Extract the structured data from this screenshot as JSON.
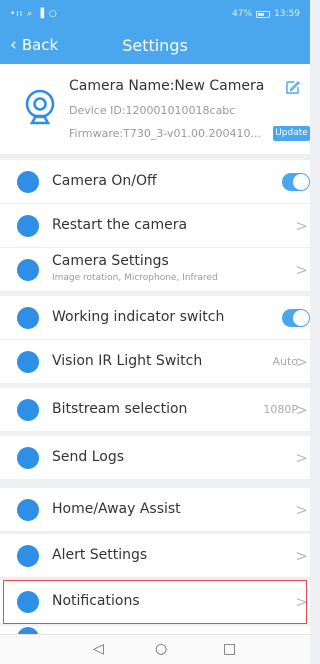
{
  "status_bar": {
    "left": "•ıı ⌕ ▐ ○",
    "battery": "47%",
    "time": "13:59"
  },
  "nav": {
    "back_label": "Back",
    "title": "Settings"
  },
  "device": {
    "name": "Camera Name:New Camera",
    "id": "Device ID:120001010018cabc",
    "firmware": "Firmware:T730_3-v01.00.200410...",
    "update_label": "Update"
  },
  "items": [
    {
      "label": "Camera On/Off",
      "control": "toggle",
      "toggle_on": true
    },
    {
      "label": "Restart the camera",
      "control": "chevron"
    },
    {
      "label": "Camera Settings",
      "subtitle": "Image rotation, Microphone, Infrared",
      "control": "chevron"
    },
    {
      "label": "Working indicator switch",
      "control": "toggle",
      "toggle_on": true
    },
    {
      "label": "Vision IR Light Switch",
      "value": "Auto",
      "control": "chevron"
    },
    {
      "label": "Bitstream selection",
      "value": "1080P",
      "control": "chevron"
    },
    {
      "label": "Send Logs",
      "control": "chevron"
    },
    {
      "label": "Home/Away Assist",
      "control": "chevron"
    },
    {
      "label": "Alert Settings",
      "control": "chevron"
    },
    {
      "label": "Notifications",
      "control": "chevron",
      "highlighted": true
    }
  ],
  "icons": {
    "camera_on_off": "webcam-icon",
    "restart": "power-icon",
    "camera_settings": "camera-settings-icon",
    "working_indicator": "light-icon",
    "ir_light": "ir-light-icon",
    "bitstream": "bitstream-icon",
    "send_logs": "document-icon",
    "home_away": "home-away-icon",
    "alert": "bell-icon",
    "notifications": "notification-icon"
  },
  "chevron": ">",
  "sysnav": {
    "back": "◁",
    "home": "○",
    "recent": "□"
  },
  "colors": {
    "accent": "#4aa7ee",
    "icon_blue": "#2f8fe6",
    "highlight_border": "#e24b54"
  }
}
